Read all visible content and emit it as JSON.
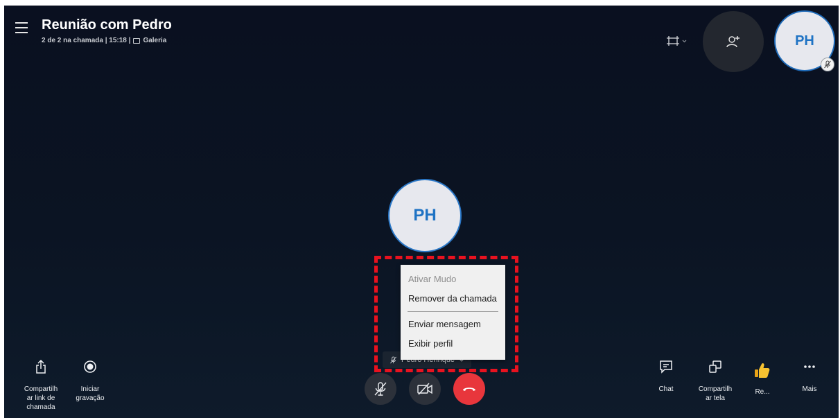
{
  "header": {
    "title": "Reunião com Pedro",
    "status": "2 de 2 na chamada | 15:18 |",
    "view_mode": "Galeria"
  },
  "top_right": {
    "participant_initials": "PH"
  },
  "main": {
    "participant_initials": "PH",
    "participant_name": "Pedro Henrique"
  },
  "context_menu": {
    "items": [
      {
        "label": "Ativar Mudo",
        "enabled": false
      },
      {
        "label": "Remover da chamada",
        "enabled": true
      },
      {
        "label": "Enviar mensagem",
        "enabled": true
      },
      {
        "label": "Exibir perfil",
        "enabled": true
      }
    ]
  },
  "bottom_left": {
    "share_link_label": "Compartilh ar link de chamada",
    "share_link_lines": [
      "Compartilh",
      "ar link de",
      "chamada"
    ],
    "record_lines": [
      "Iniciar",
      "gravação"
    ]
  },
  "bottom_right": {
    "chat_label": "Chat",
    "share_screen_lines": [
      "Compartilh",
      "ar tela"
    ],
    "react_label": "Re...",
    "more_label": "Mais"
  },
  "colors": {
    "background": "#0b1423",
    "accent_blue": "#1f73c4",
    "hangup_red": "#e8363c",
    "highlight_red": "#e8121f"
  }
}
